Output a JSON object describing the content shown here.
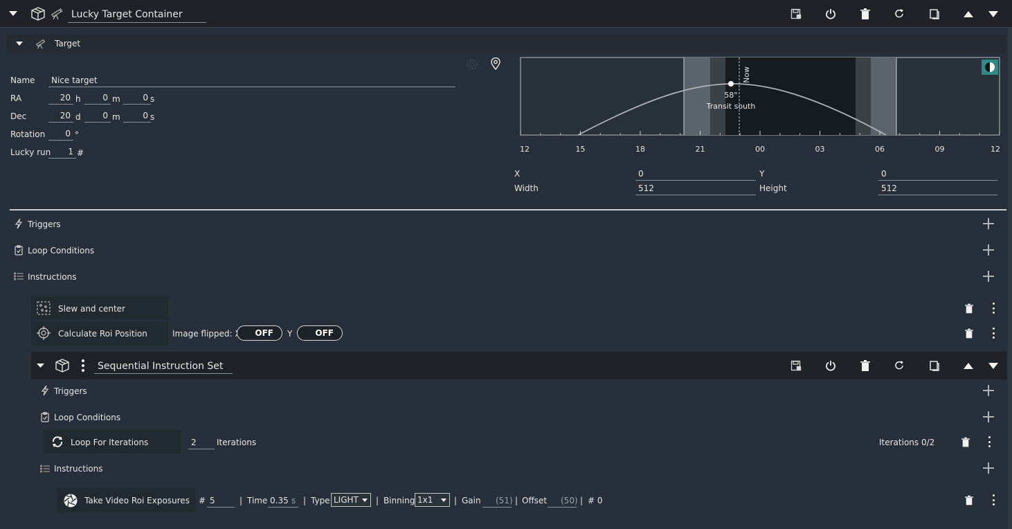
{
  "container": {
    "title": "Lucky Target Container",
    "target_header": "Target",
    "name_label": "Name",
    "name_value": "Nice target",
    "ra_label": "RA",
    "ra": {
      "h": "20",
      "h_unit": "h",
      "m": "0",
      "m_unit": "m",
      "s": "0",
      "s_unit": "s"
    },
    "dec_label": "Dec",
    "dec": {
      "d": "20",
      "d_unit": "d",
      "m": "0",
      "m_unit": "m",
      "s": "0",
      "s_unit": "s"
    },
    "rotation_label": "Rotation",
    "rotation_value": "0",
    "rotation_unit": "°",
    "lucky_label": "Lucky run",
    "lucky_value": "1",
    "lucky_unit": "#",
    "roi": {
      "x_label": "X",
      "x_value": "0",
      "y_label": "Y",
      "y_value": "0",
      "width_label": "Width",
      "width_value": "512",
      "height_label": "Height",
      "height_value": "512"
    },
    "triggers_label": "Triggers",
    "loop_conditions_label": "Loop Conditions",
    "instructions_label": "Instructions"
  },
  "altitude_chart": {
    "ticks": [
      "12",
      "15",
      "18",
      "21",
      "00",
      "03",
      "06",
      "09",
      "12"
    ],
    "now_label": "Now",
    "peak_label": "58°",
    "transit_label": "Transit south",
    "colors": {
      "night": "#161b1f",
      "twilight_dark": "#3a4147",
      "twilight_light": "#5b646c",
      "day": "#28313a",
      "curve": "#aeb3b8"
    }
  },
  "items": {
    "slew": "Slew and center",
    "roi_position": "Calculate Roi Position",
    "image_flipped_x": "Image flipped: X",
    "off_x": "OFF",
    "y_label": "Y",
    "off_y": "OFF"
  },
  "sequential": {
    "title": "Sequential Instruction Set",
    "triggers_label": "Triggers",
    "loop_conditions_label": "Loop Conditions",
    "loop_for": "Loop For Iterations",
    "iterations_value": "2",
    "iterations_label": "Iterations",
    "iterations_status": "Iterations 0/2",
    "instructions_label": "Instructions",
    "exposure": {
      "name": "Take Video Roi Exposures",
      "count_label": "#",
      "count": "5",
      "sep1": "|",
      "time_label": "Time",
      "time": "0.35",
      "time_unit": "s",
      "sep2": "|",
      "type_label": "Type",
      "type": "LIGHT",
      "sep3": "|",
      "binning_label": "Binning",
      "binning": "1x1",
      "sep4": "|",
      "gain_label": "Gain",
      "gain": "(51)",
      "sep5": "|",
      "offset_label": "Offset",
      "offset": "(50)",
      "sep6": "|",
      "progress": "# 0"
    }
  }
}
